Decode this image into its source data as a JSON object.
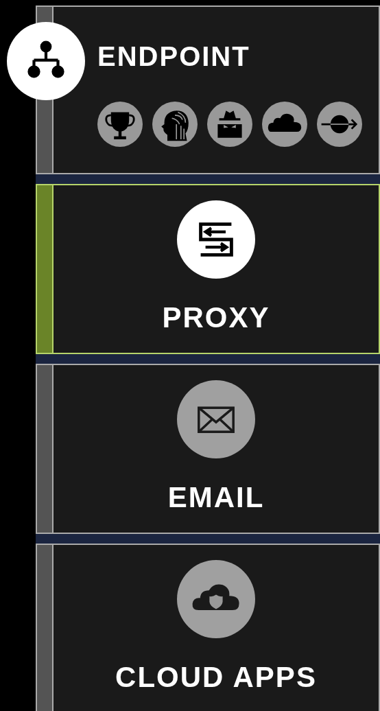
{
  "sections": [
    {
      "kind": "header",
      "title": "ENDPOINT",
      "selected": false
    },
    {
      "kind": "card",
      "title": "PROXY",
      "selected": true
    },
    {
      "kind": "card",
      "title": "EMAIL",
      "selected": false
    },
    {
      "kind": "card",
      "title": "CLOUD APPS",
      "selected": false
    }
  ]
}
